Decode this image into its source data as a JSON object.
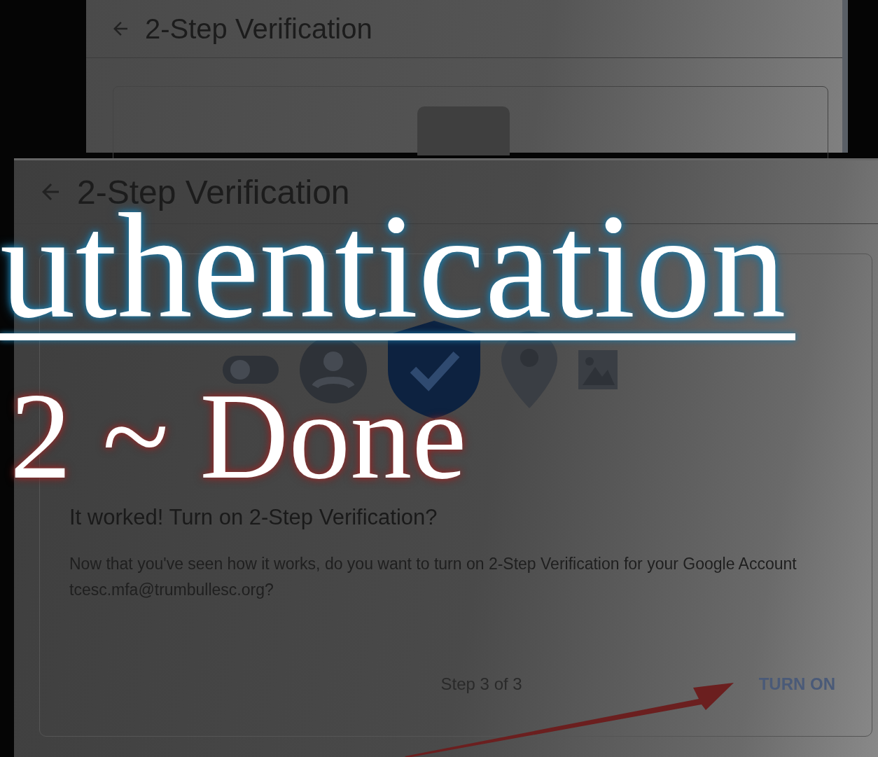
{
  "back_window": {
    "title": "2-Step Verification"
  },
  "front_window": {
    "title": "2-Step Verification",
    "heading": "It worked! Turn on 2-Step Verification?",
    "body": "Now that you've seen how it works, do you want to turn on 2-Step Verification for your Google Account tcesc.mfa@trumbullesc.org?",
    "step": "Step 3 of 3",
    "action": "TURN ON"
  },
  "overlay": {
    "headline": "uthentication",
    "subtitle": "2 ~ Done"
  }
}
